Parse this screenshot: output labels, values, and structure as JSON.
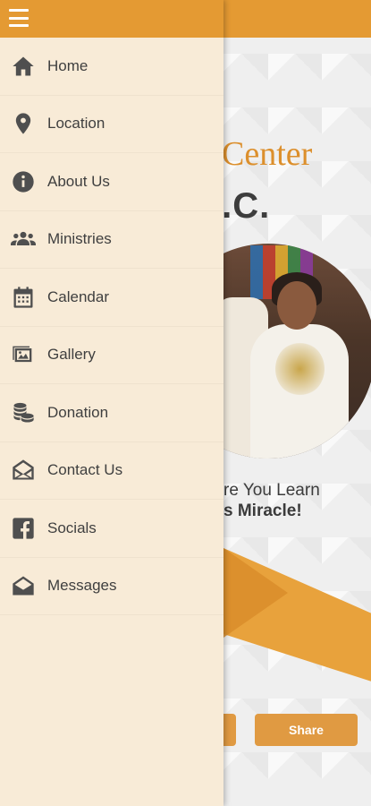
{
  "app": {
    "church_name_fragment": "Center",
    "church_abbrev_fragment": "I.C.",
    "tagline_line1": "re You Learn",
    "tagline_line2": "s Miracle!",
    "share_label": "Share"
  },
  "colors": {
    "brand_orange": "#e49a33",
    "drawer_bg": "#f8ebd7",
    "icon_gray": "#4f4f4f"
  },
  "drawer": {
    "items": [
      {
        "label": "Home",
        "icon": "home-icon"
      },
      {
        "label": "Location",
        "icon": "location-pin-icon"
      },
      {
        "label": "About Us",
        "icon": "info-icon"
      },
      {
        "label": "Ministries",
        "icon": "people-group-icon"
      },
      {
        "label": "Calendar",
        "icon": "calendar-icon"
      },
      {
        "label": "Gallery",
        "icon": "gallery-icon"
      },
      {
        "label": "Donation",
        "icon": "coins-icon"
      },
      {
        "label": "Contact Us",
        "icon": "envelope-open-icon"
      },
      {
        "label": "Socials",
        "icon": "facebook-icon"
      },
      {
        "label": "Messages",
        "icon": "mail-icon"
      }
    ]
  }
}
